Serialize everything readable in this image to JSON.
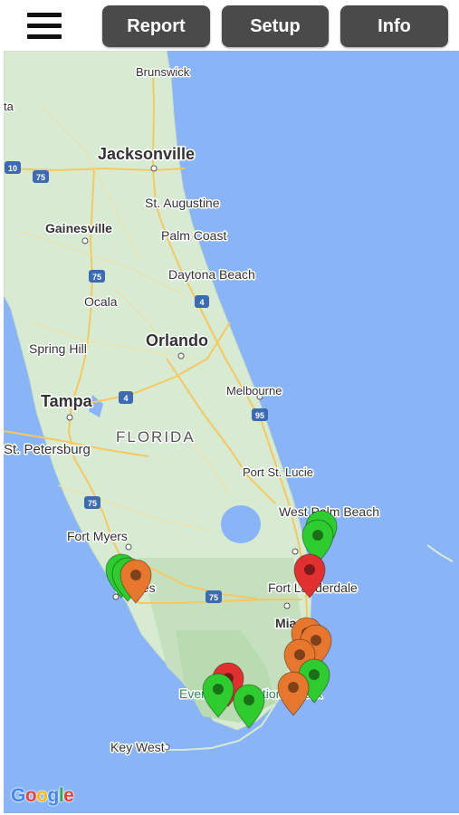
{
  "toolbar": {
    "menu_icon": "hamburger-menu-icon",
    "buttons": [
      {
        "id": "report",
        "label": "Report"
      },
      {
        "id": "setup",
        "label": "Setup"
      },
      {
        "id": "info",
        "label": "Info"
      }
    ]
  },
  "map": {
    "region_label": "FLORIDA",
    "city_labels": [
      {
        "name": "Brunswick",
        "major": false
      },
      {
        "name": "Jacksonville",
        "major": true
      },
      {
        "name": "St. Augustine",
        "major": false
      },
      {
        "name": "Gainesville",
        "major": false
      },
      {
        "name": "Palm Coast",
        "major": false
      },
      {
        "name": "Daytona Beach",
        "major": false
      },
      {
        "name": "Ocala",
        "major": false
      },
      {
        "name": "Orlando",
        "major": true
      },
      {
        "name": "Spring Hill",
        "major": false
      },
      {
        "name": "Tampa",
        "major": true
      },
      {
        "name": "Melbourne",
        "major": false
      },
      {
        "name": "St. Petersburg",
        "major": false
      },
      {
        "name": "Port St. Lucie",
        "major": false
      },
      {
        "name": "West Palm Beach",
        "major": false
      },
      {
        "name": "Fort Myers",
        "major": false
      },
      {
        "name": "Fort Lauderdale",
        "major": false
      },
      {
        "name": "Naples",
        "major": false
      },
      {
        "name": "Miami",
        "major": false
      },
      {
        "name": "Everglades National Park",
        "major": false
      },
      {
        "name": "Key West",
        "major": false
      }
    ],
    "highway_shields": [
      "10",
      "75",
      "75",
      "4",
      "4",
      "95",
      "75",
      "75"
    ],
    "edge_label": "ta",
    "attribution": "Google",
    "marker_colors": {
      "green": "#2ecc2e",
      "orange": "#e8772e",
      "red": "#e03030"
    },
    "markers": [
      {
        "color": "green"
      },
      {
        "color": "green"
      },
      {
        "color": "red"
      },
      {
        "color": "green"
      },
      {
        "color": "green"
      },
      {
        "color": "orange"
      },
      {
        "color": "orange"
      },
      {
        "color": "orange"
      },
      {
        "color": "orange"
      },
      {
        "color": "green"
      },
      {
        "color": "orange"
      },
      {
        "color": "red"
      },
      {
        "color": "green"
      },
      {
        "color": "green"
      }
    ]
  }
}
